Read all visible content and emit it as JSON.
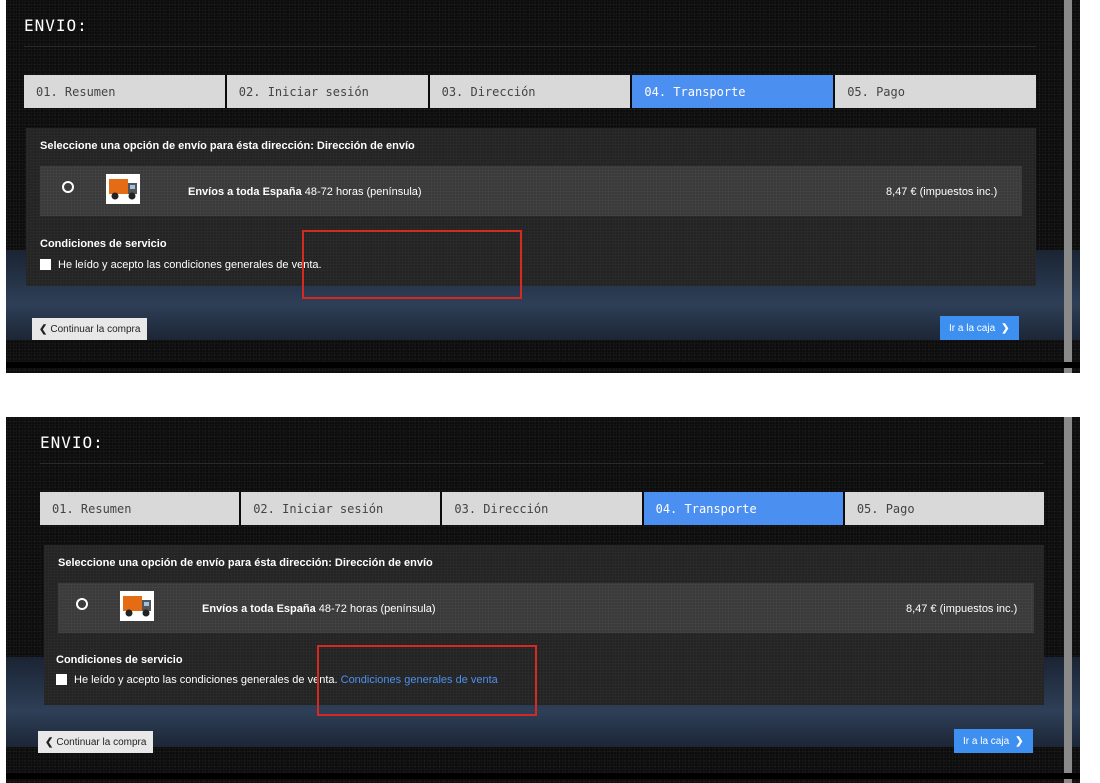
{
  "section_title": "ENVIO:",
  "steps": [
    {
      "label": "01. Resumen"
    },
    {
      "label": "02. Iniciar sesión"
    },
    {
      "label": "03. Dirección"
    },
    {
      "label": "04. Transporte"
    },
    {
      "label": "05. Pago"
    }
  ],
  "active_step": 3,
  "shipping": {
    "heading": "Seleccione una opción de envío para ésta dirección: Dirección de envío",
    "carrier_name_bold": "Envíos a toda España",
    "carrier_delay": " 48-72 horas (península)",
    "price": "8,47 € (impuestos inc.)",
    "truck_icon": "truck-icon"
  },
  "terms": {
    "heading": "Condiciones de servicio",
    "text": "He leído y acepto las condiciones generales de venta.",
    "link_text": "Condiciones generales de venta"
  },
  "buttons": {
    "back": "Continuar la compra",
    "next": "Ir a la caja"
  },
  "colors": {
    "accent": "#4b8ff0",
    "highlight_box": "#d42a22"
  }
}
